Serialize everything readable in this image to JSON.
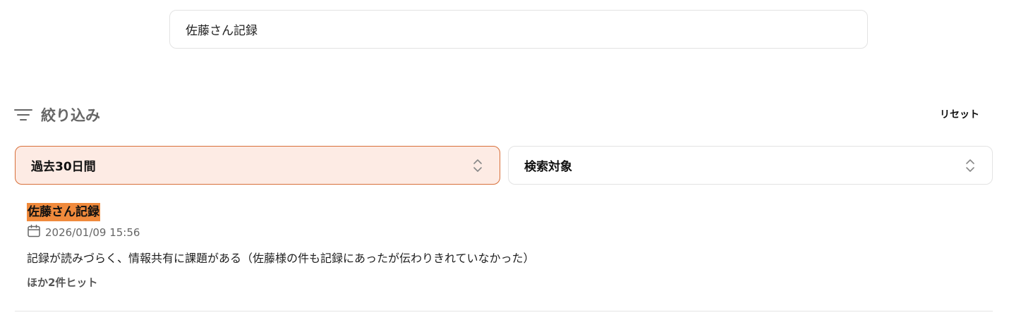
{
  "search": {
    "value": "佐藤さん記録"
  },
  "filter": {
    "title": "絞り込み",
    "reset_label": "リセット",
    "period_select": {
      "selected": "過去30日間"
    },
    "target_select": {
      "selected": "検索対象"
    }
  },
  "results": [
    {
      "title": "佐藤さん記録",
      "date": "2026/01/09 15:56",
      "snippet": "記録が読みづらく、情報共有に課題がある（佐藤様の件も記録にあったが伝わりきれていなかった）",
      "more": "ほか2件ヒット"
    }
  ],
  "colors": {
    "accent": "#d8703a",
    "accent_bg": "#fdebe4",
    "highlight": "#f08a3c"
  }
}
